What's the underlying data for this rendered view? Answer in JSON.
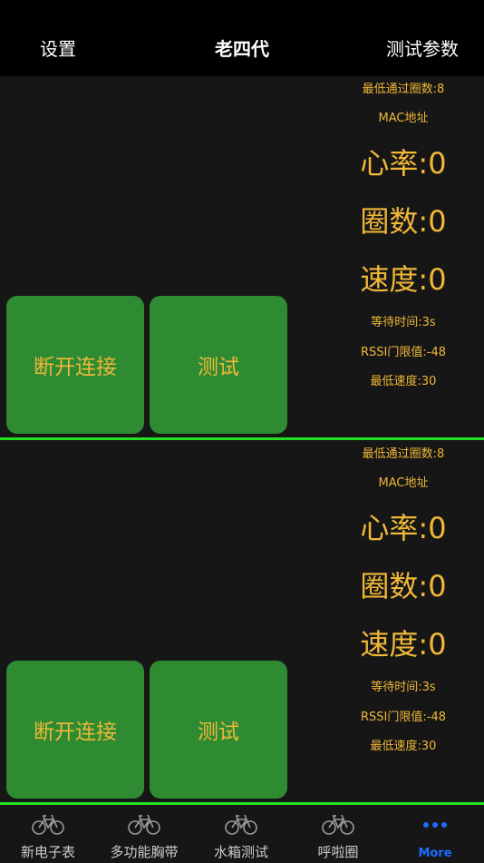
{
  "navbar": {
    "left": "设置",
    "title": "老四代",
    "right": "测试参数"
  },
  "sections": [
    {
      "buttons": {
        "disconnect": "断开连接",
        "test": "测试"
      },
      "info": {
        "min_laps": "最低通过圈数:8",
        "mac": "MAC地址",
        "heart_rate": "心率:0",
        "laps": "圈数:0",
        "speed": "速度:0",
        "wait_time": "等待时间:3s",
        "rssi": "RSSI门限值:-48",
        "min_speed": "最低速度:30"
      }
    },
    {
      "buttons": {
        "disconnect": "断开连接",
        "test": "测试"
      },
      "info": {
        "min_laps": "最低通过圈数:8",
        "mac": "MAC地址",
        "heart_rate": "心率:0",
        "laps": "圈数:0",
        "speed": "速度:0",
        "wait_time": "等待时间:3s",
        "rssi": "RSSI门限值:-48",
        "min_speed": "最低速度:30"
      }
    }
  ],
  "tabbar": {
    "tabs": [
      {
        "label": "新电子表",
        "icon": "bicycle-icon"
      },
      {
        "label": "多功能胸带",
        "icon": "bicycle-icon"
      },
      {
        "label": "水箱测试",
        "icon": "bicycle-icon"
      },
      {
        "label": "呼啦圈",
        "icon": "bicycle-icon"
      },
      {
        "label": "More",
        "icon": "more-dots-icon"
      }
    ],
    "active_index": 4
  },
  "colors": {
    "background": "#161616",
    "navbar": "#000000",
    "button": "#2e8b32",
    "text_accent": "#f0b838",
    "divider": "#22e022",
    "tab_active": "#1e6bff",
    "tab_inactive": "#cccccc"
  }
}
